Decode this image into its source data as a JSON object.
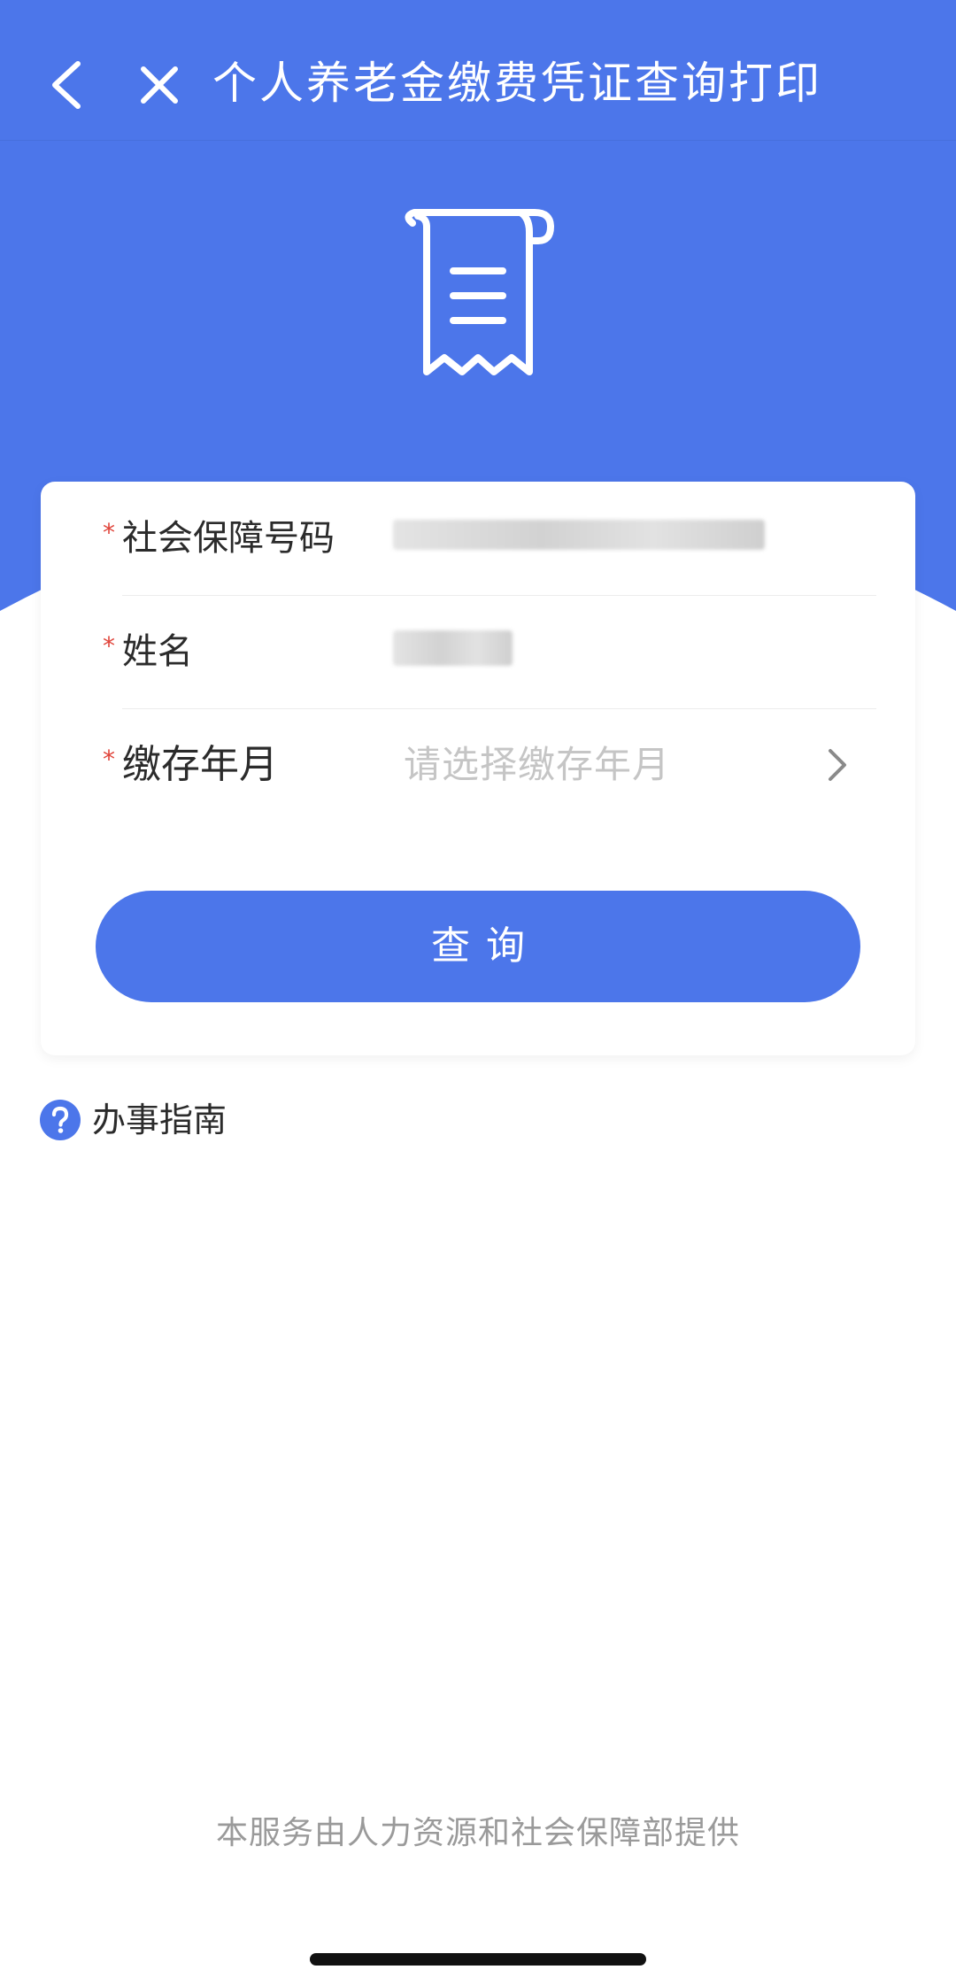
{
  "header": {
    "title": "个人养老金缴费凭证查询打印",
    "back_icon": "chevron-left-icon",
    "close_icon": "close-icon"
  },
  "hero": {
    "icon": "receipt-icon"
  },
  "form": {
    "ssn": {
      "label": "社会保障号码",
      "required_mark": "*",
      "value_state": "blurred"
    },
    "name": {
      "label": "姓名",
      "required_mark": "*",
      "value_state": "blurred"
    },
    "pay_month": {
      "label": "缴存年月",
      "required_mark": "*",
      "placeholder": "请选择缴存年月",
      "icon": "chevron-right-icon"
    },
    "query_button_label": "查询"
  },
  "guide": {
    "label": "办事指南",
    "icon": "help-icon"
  },
  "footer": {
    "text": "本服务由人力资源和社会保障部提供"
  },
  "colors": {
    "primary": "#4c76ea",
    "required": "#e0443a",
    "placeholder": "#c5c5c5",
    "footer_text": "#9a9a9a",
    "label_text": "#2b2b2b"
  }
}
